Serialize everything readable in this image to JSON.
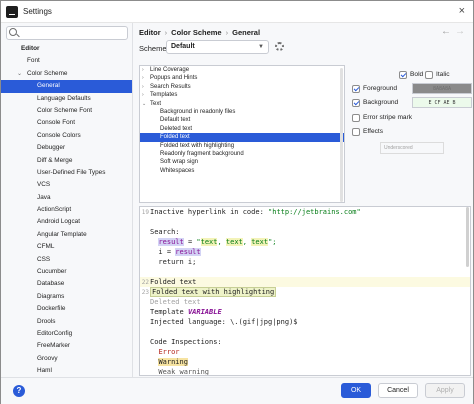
{
  "window": {
    "title": "Settings",
    "close_glyph": "×"
  },
  "sidebar": {
    "search_placeholder": "",
    "items": [
      {
        "label": "Editor",
        "level": 0
      },
      {
        "label": "Font",
        "level": 1
      },
      {
        "label": "Color Scheme",
        "level": 1,
        "expanded": true
      },
      {
        "label": "General",
        "level": 2,
        "selected": true
      },
      {
        "label": "Language Defaults",
        "level": 2
      },
      {
        "label": "Color Scheme Font",
        "level": 2
      },
      {
        "label": "Console Font",
        "level": 2
      },
      {
        "label": "Console Colors",
        "level": 2
      },
      {
        "label": "Debugger",
        "level": 2
      },
      {
        "label": "Diff & Merge",
        "level": 2
      },
      {
        "label": "User-Defined File Types",
        "level": 2
      },
      {
        "label": "VCS",
        "level": 2
      },
      {
        "label": "Java",
        "level": 2
      },
      {
        "label": "ActionScript",
        "level": 2
      },
      {
        "label": "Android Logcat",
        "level": 2
      },
      {
        "label": "Angular Template",
        "level": 2
      },
      {
        "label": "CFML",
        "level": 2
      },
      {
        "label": "CSS",
        "level": 2
      },
      {
        "label": "Cucumber",
        "level": 2
      },
      {
        "label": "Database",
        "level": 2
      },
      {
        "label": "Diagrams",
        "level": 2
      },
      {
        "label": "Dockerfile",
        "level": 2
      },
      {
        "label": "Drools",
        "level": 2
      },
      {
        "label": "EditorConfig",
        "level": 2
      },
      {
        "label": "FreeMarker",
        "level": 2
      },
      {
        "label": "Groovy",
        "level": 2
      },
      {
        "label": "Haml",
        "level": 2
      }
    ]
  },
  "breadcrumb": {
    "items": [
      "Editor",
      "Color Scheme",
      "General"
    ],
    "separator": "›"
  },
  "nav": {
    "back": "←",
    "forward": "→"
  },
  "scheme": {
    "label": "Scheme:",
    "value": "Default"
  },
  "attributes": {
    "items": [
      {
        "label": "Line Coverage",
        "level": 0,
        "chevron": "›"
      },
      {
        "label": "Popups and Hints",
        "level": 0,
        "chevron": "›"
      },
      {
        "label": "Search Results",
        "level": 0,
        "chevron": "›"
      },
      {
        "label": "Templates",
        "level": 0,
        "chevron": "›"
      },
      {
        "label": "Text",
        "level": 0,
        "chevron": "⌄"
      },
      {
        "label": "Background in readonly files",
        "level": 1
      },
      {
        "label": "Default text",
        "level": 1
      },
      {
        "label": "Deleted text",
        "level": 1
      },
      {
        "label": "Folded text",
        "level": 1,
        "selected": true
      },
      {
        "label": "Folded text with highlighting",
        "level": 1
      },
      {
        "label": "Readonly fragment background",
        "level": 1
      },
      {
        "label": "Soft wrap sign",
        "level": 1
      },
      {
        "label": "Whitespaces",
        "level": 1
      }
    ]
  },
  "options": {
    "bold": {
      "label": "Bold",
      "checked": true
    },
    "italic": {
      "label": "Italic",
      "checked": false
    },
    "foreground": {
      "label": "Foreground",
      "checked": true,
      "value": "8A8A8A",
      "color": "#8a8a8a"
    },
    "background": {
      "label": "Background",
      "checked": true,
      "value": "E CF AE B",
      "color": "#ecfaeb"
    },
    "error_stripe": {
      "label": "Error stripe mark",
      "checked": false
    },
    "effects": {
      "label": "Effects",
      "checked": false
    },
    "effect_type": "Underscored"
  },
  "preview": {
    "lines": [
      {
        "n": "19",
        "parts": [
          [
            "Inactive hyperlink in code: ",
            ""
          ],
          [
            "\"http://jetbrains.com\"",
            "str"
          ]
        ]
      },
      {
        "n": "",
        "parts": []
      },
      {
        "n": "",
        "parts": [
          [
            "Search:",
            ""
          ]
        ]
      },
      {
        "n": "",
        "parts": [
          [
            "  ",
            ""
          ],
          [
            "result",
            "var hl-var"
          ],
          [
            " = ",
            ""
          ],
          [
            "\"",
            "str"
          ],
          [
            "text",
            "str str-hl"
          ],
          [
            ", ",
            "str"
          ],
          [
            "text",
            "str str-hl"
          ],
          [
            ", ",
            "str"
          ],
          [
            "text",
            "str str-hl"
          ],
          [
            "\";",
            "str"
          ]
        ]
      },
      {
        "n": "",
        "parts": [
          [
            "  i = ",
            ""
          ],
          [
            "result",
            "var hl-var"
          ]
        ]
      },
      {
        "n": "",
        "parts": [
          [
            "  return i;",
            ""
          ]
        ]
      },
      {
        "n": "",
        "parts": []
      },
      {
        "n": "22",
        "parts": [
          [
            "Folded text",
            ""
          ]
        ],
        "hl": true
      },
      {
        "n": "23",
        "parts": [
          [
            "Folded text with highlighting",
            "folded"
          ]
        ]
      },
      {
        "n": "",
        "parts": [
          [
            "Deleted text",
            "deleted"
          ]
        ]
      },
      {
        "n": "",
        "parts": [
          [
            "Template ",
            ""
          ],
          [
            "VARIABLE",
            "tmpl"
          ]
        ]
      },
      {
        "n": "",
        "parts": [
          [
            "Injected language: \\.(gif|jpg|png)$",
            ""
          ]
        ]
      },
      {
        "n": "",
        "parts": []
      },
      {
        "n": "",
        "parts": [
          [
            "Code Inspections:",
            ""
          ]
        ]
      },
      {
        "n": "",
        "parts": [
          [
            "  ",
            ""
          ],
          [
            "Error",
            "err"
          ]
        ]
      },
      {
        "n": "",
        "parts": [
          [
            "  ",
            ""
          ],
          [
            "Warning",
            "warn"
          ]
        ]
      },
      {
        "n": "",
        "parts": [
          [
            "  Weak warning",
            "weak"
          ]
        ]
      }
    ]
  },
  "footer": {
    "help": "?",
    "ok": "OK",
    "cancel": "Cancel",
    "apply": "Apply"
  },
  "colors": {
    "accent": "#2a5bd8",
    "selection_text": "#ffffff"
  }
}
